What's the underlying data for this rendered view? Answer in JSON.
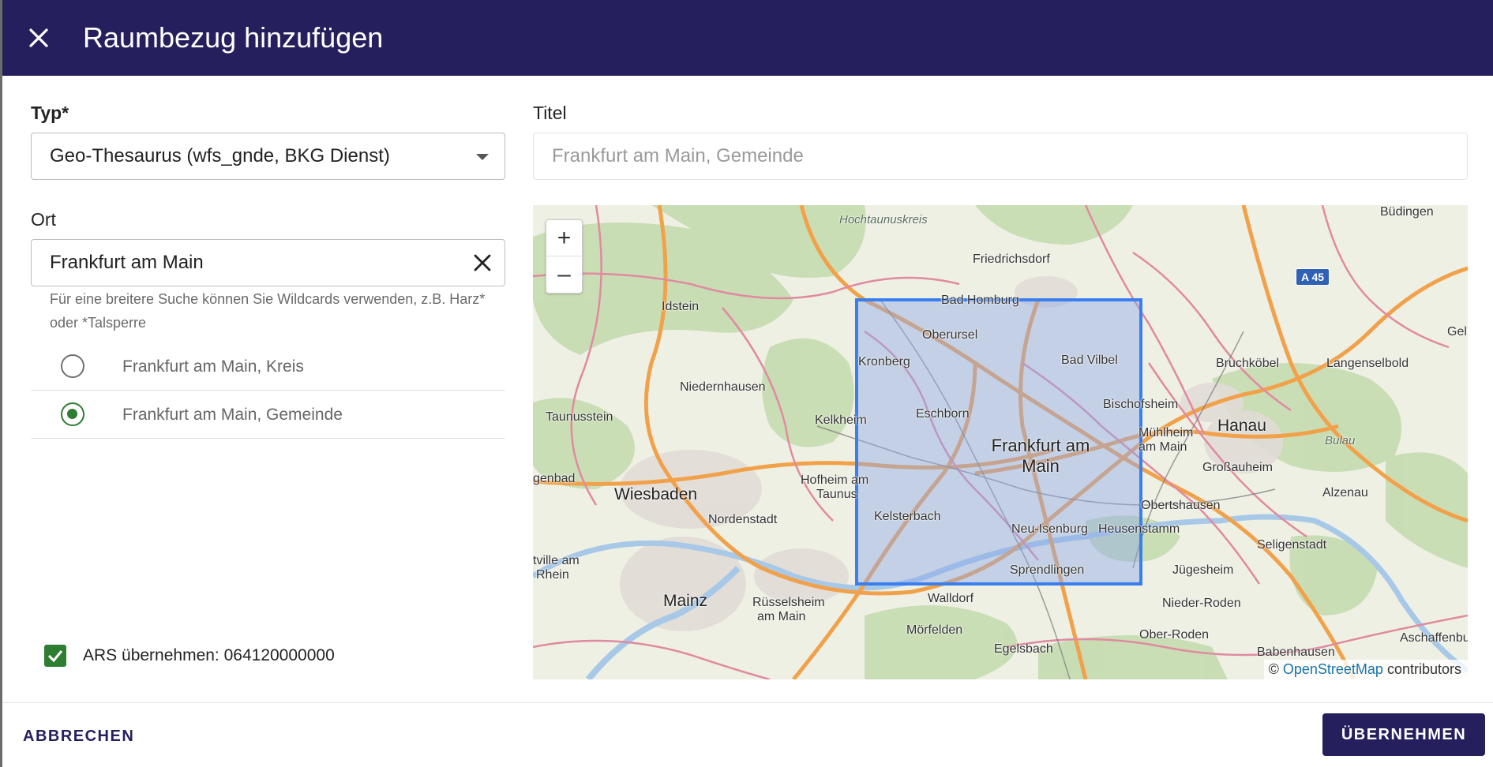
{
  "dialog": {
    "title": "Raumbezug hinzufügen",
    "close_icon": "close-icon"
  },
  "form": {
    "type_label": "Typ*",
    "type_value": "Geo-Thesaurus (wfs_gnde, BKG Dienst)",
    "title_label": "Titel",
    "title_value": "Frankfurt am Main, Gemeinde",
    "place_label": "Ort",
    "place_value": "Frankfurt am Main",
    "hint": "Für eine breitere Suche können Sie Wildcards verwenden, z.B. Harz* oder *Talsperre",
    "results": [
      {
        "label": "Frankfurt am Main, Kreis",
        "selected": false
      },
      {
        "label": "Frankfurt am Main, Gemeinde",
        "selected": true
      }
    ],
    "ars_checkbox_label": "ARS übernehmen: 064120000000",
    "ars_checked": true
  },
  "map": {
    "zoom_in": "+",
    "zoom_out": "–",
    "attribution_prefix": "©",
    "attribution_link": "OpenStreetMap",
    "attribution_suffix": "contributors",
    "selection_color": "#3a7ff0",
    "labels": {
      "hochtaunuskreis": "Hochtaunuskreis",
      "friedrichsdorf": "Friedrichsdorf",
      "buedingen": "Büdingen",
      "a45": "A 45",
      "idstein": "Idstein",
      "bad_homburg": "Bad Homburg",
      "oberursel": "Oberursel",
      "gelnhausen": "Geln",
      "kronberg": "Kronberg",
      "bad_vilbel": "Bad Vilbel",
      "bruchkoebel": "Bruchköbel",
      "langenselbold": "Langenselbold",
      "niedernhausen": "Niedernhausen",
      "taunusstein": "Taunusstein",
      "kelkheim": "Kelkheim",
      "eschborn": "Eschborn",
      "bischofsheim": "Bischofsheim",
      "hanau": "Hanau",
      "muehlheim": "Mühlheim",
      "am_main": "am Main",
      "bulau": "Bulau",
      "frankfurt": "Frankfurt am Main",
      "gensbad": "genbad",
      "wiesbaden": "Wiesbaden",
      "hofheim": "Hofheim am",
      "taunus": "Taunus",
      "grossauheim": "Großauheim",
      "alzenau": "Alzenau",
      "nordenstadt": "Nordenstadt",
      "kelsterbach": "Kelsterbach",
      "neu_isenburg": "Neu-Isenburg",
      "heusenstamm": "Heusenstamm",
      "obertshausen": "Obertshausen",
      "seligenstadt": "Seligenstadt",
      "tville": "tville am",
      "rhein": "Rhein",
      "sprendlingen": "Sprendlingen",
      "juegesheim": "Jügesheim",
      "mainz": "Mainz",
      "ruesselsheim": "Rüsselsheim",
      "ruesselsheim2": "am Main",
      "walldorf": "Walldorf",
      "nieder_roden": "Nieder-Roden",
      "moerfelden": "Mörfelden",
      "egelsbach": "Egelsbach",
      "ober_roden": "Ober-Roden",
      "aschaffenburg": "Aschaffenbu",
      "babenhausen": "Babenhausen"
    }
  },
  "footer": {
    "cancel_label": "ABBRECHEN",
    "apply_label": "ÜBERNEHMEN"
  }
}
